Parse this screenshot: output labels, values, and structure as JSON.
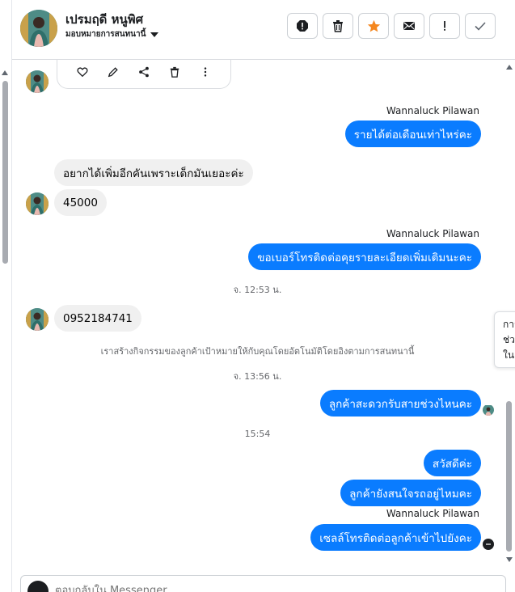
{
  "header": {
    "contact_name": "เปรมฤดี หนูพิศ",
    "assign_label": "มอบหมายการสนทนานี้",
    "actions": [
      {
        "name": "report-icon"
      },
      {
        "name": "trash-icon"
      },
      {
        "name": "star-icon"
      },
      {
        "name": "mail-icon"
      },
      {
        "name": "exclamation-icon"
      },
      {
        "name": "check-icon"
      }
    ]
  },
  "colors": {
    "accent": "#0a7cff",
    "incoming_bubble": "#f0f0f0",
    "star": "#f5871f"
  },
  "reaction_icons": [
    "heart-icon",
    "pencil-icon",
    "share-icon",
    "trash-icon",
    "more-icon"
  ],
  "thread": {
    "sender_1": "Wannaluck Pilawan",
    "msg_1": "รายได้ต่อเดือนเท่าไหร่คะ",
    "msg_2": "อยากได้เพิ่มอีกคันเพราะเด็กมันเยอะค่ะ",
    "msg_3": "45000",
    "sender_2": "Wannaluck Pilawan",
    "msg_4": "ขอเบอร์โทรติดต่อคุยรายละเอียดเพิ่มเติมนะคะ",
    "ts_1": "จ. 12:53 น.",
    "msg_5": "0952184741",
    "system_note": "เราสร้างกิจกรรมของลูกค้าเป้าหมายให้กับคุณโดยอัตโนมัติโดยอิงตามการสนทนานี้",
    "ts_2": "จ. 13:56 น.",
    "msg_6": "ลูกค้าสะดวกรับสายช่วงไหนคะ",
    "ts_3": "15:54",
    "msg_7": "สวัสดีค่ะ",
    "msg_8": "ลูกค้ายังสนใจรถอยู่ไหมคะ",
    "sender_3": "Wannaluck Pilawan",
    "msg_9": "เซลล์โทรติดต่อลูกค้าเข้าไปยังคะ"
  },
  "side_card": {
    "line_1": "การ",
    "line_2": "ช่ว",
    "line_3": "ใน"
  },
  "composer": {
    "placeholder": "ตอบกลับใน Messenger..."
  }
}
